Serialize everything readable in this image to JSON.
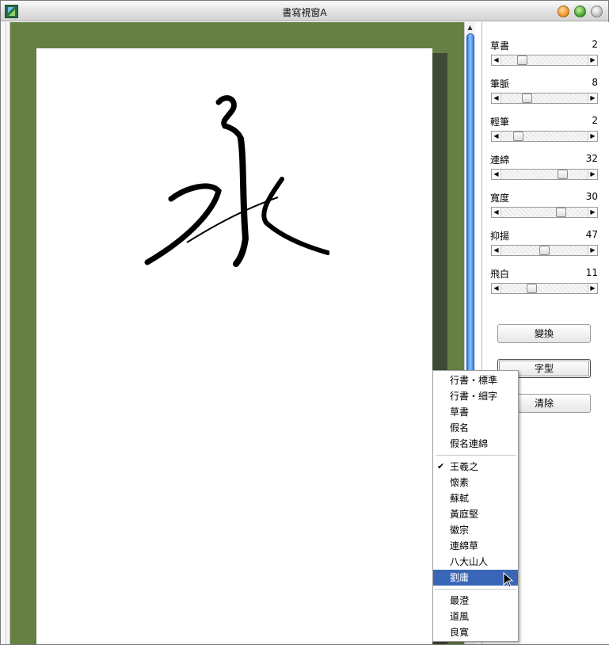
{
  "window": {
    "title": "書寫視窗A"
  },
  "params": [
    {
      "label": "草書",
      "value": "2",
      "level": 0.2
    },
    {
      "label": "筆脈",
      "value": "8",
      "level": 0.27
    },
    {
      "label": "輕筆",
      "value": "2",
      "level": 0.15
    },
    {
      "label": "連綿",
      "value": "32",
      "level": 0.74
    },
    {
      "label": "寬度",
      "value": "30",
      "level": 0.72
    },
    {
      "label": "抑揚",
      "value": "47",
      "level": 0.5
    },
    {
      "label": "飛白",
      "value": "11",
      "level": 0.33
    }
  ],
  "buttons": {
    "convert": "變換",
    "font": "字型",
    "clear": "清除"
  },
  "menu": {
    "group1": [
      "行書・標準",
      "行書・細字",
      "草書",
      "假名",
      "假名連綿"
    ],
    "group2": [
      "王羲之",
      "懷素",
      "蘇軾",
      "黃庭堅",
      "徽宗",
      "連綿草",
      "八大山人",
      "劉庸"
    ],
    "group3": [
      "最澄",
      "道風",
      "良寛"
    ],
    "checked": "王羲之",
    "highlighted": "劉庸"
  },
  "colors": {
    "canvas_bg": "#667f42",
    "highlight": "#3a66b8"
  }
}
